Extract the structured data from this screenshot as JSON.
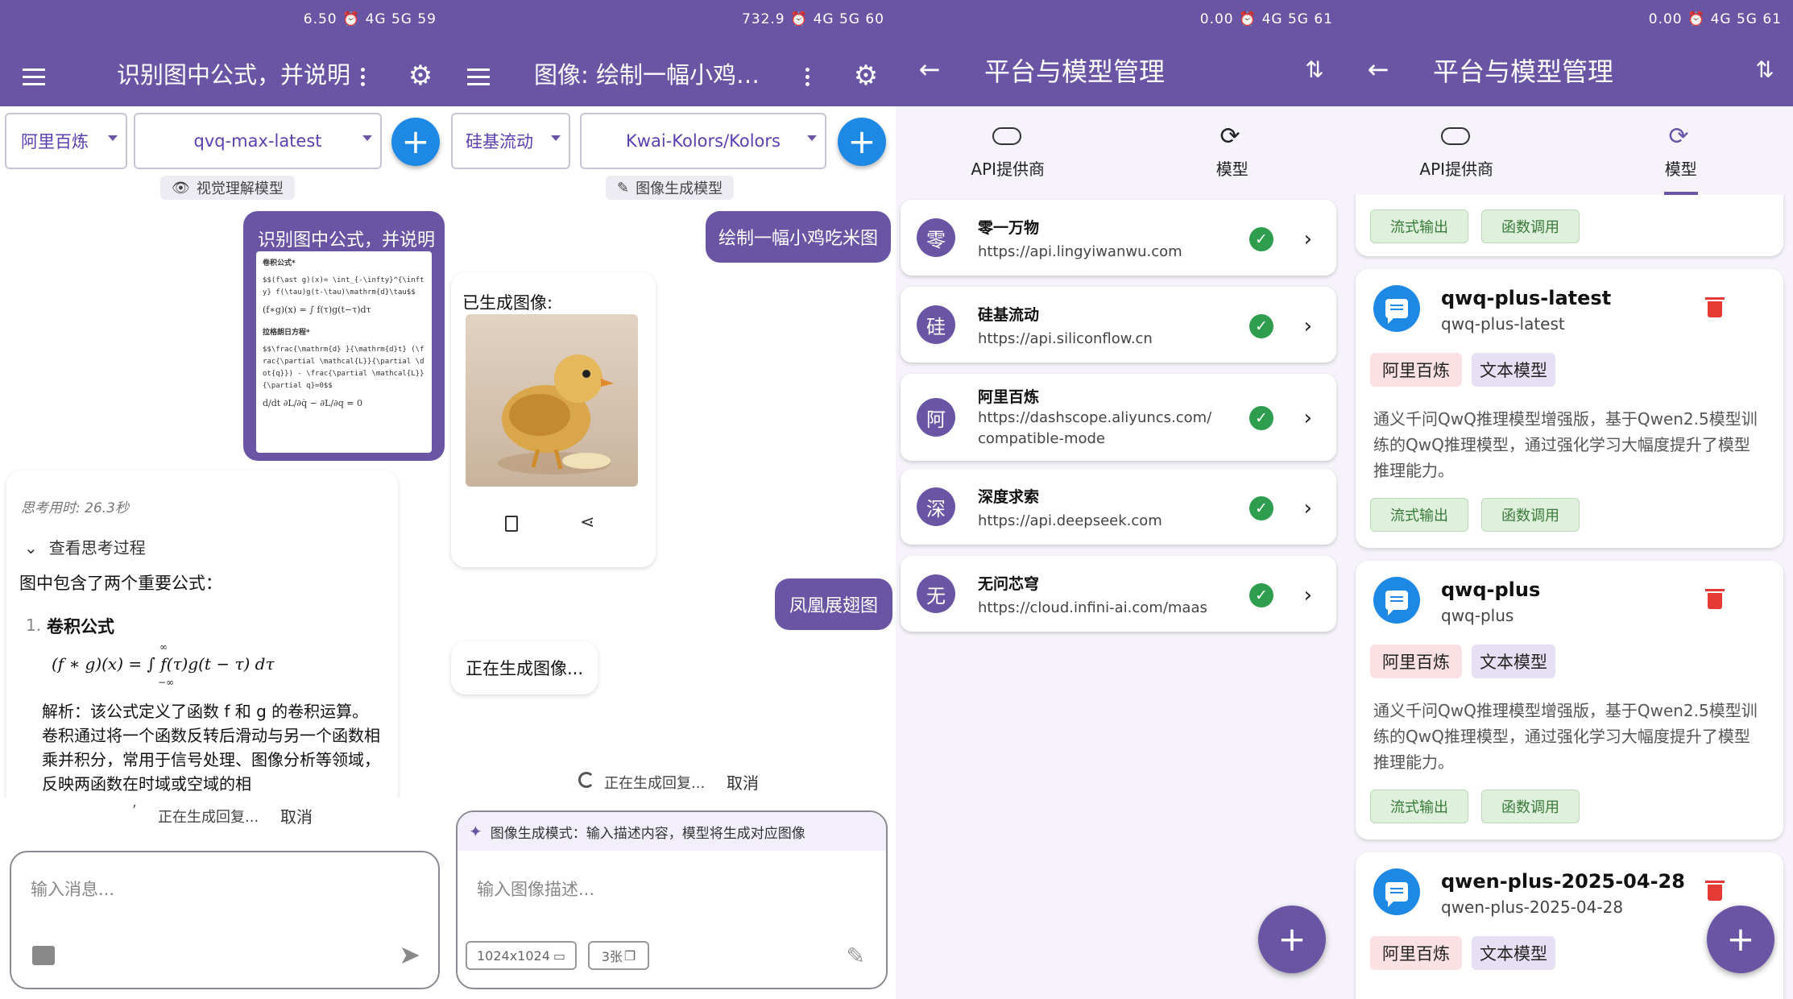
{
  "colors": {
    "primary": "#6a55a5",
    "fab_blue": "#1e88e5",
    "ok_green": "#2e9e4e",
    "delete_red": "#e53935"
  },
  "p1": {
    "status": "6.50 ⏰ 4G 5G 59",
    "title": "识别图中公式，并说明",
    "provider": "阿里百炼",
    "model": "qvq-max-latest",
    "model_badge": "视觉理解模型",
    "user_msg": "识别图中公式，并说明",
    "img_h1": "卷积公式*",
    "img_l1": "$$(f\\ast g)(x)= \\int_{-\\infty}^{\\infty} f(\\tau)g(t-\\tau)\\mathrm{d}\\tau$$",
    "img_l2": "(f∗g)(x) = ∫ f(τ)g(t−τ)dτ",
    "img_h2": "拉格朗日方程*",
    "img_l3": "$$\\frac{\\mathrm{d} }{\\mathrm{d}t} (\\frac{\\partial \\mathcal{L}}{\\partial \\dot{q}}) - \\frac{\\partial \\mathcal{L}}{\\partial q}=0$$",
    "img_l4": "d/dt ∂L/∂q̇ − ∂L/∂q = 0",
    "think_time": "思考用时: 26.3秒",
    "view_thinking": "查看思考过程",
    "answer_intro": "图中包含了两个重要公式：",
    "item_num": "1.",
    "item_title": "卷积公式",
    "formula": "(f ∗ g)(x) = ∫ f(τ)g(t − τ) dτ",
    "f_upper": "∞",
    "f_lower": "−∞",
    "explain": "解析：该公式定义了函数 f 和 g 的卷积运算。卷积通过将一个函数反转后滑动与另一个函数相乘并积分，常用于信号处理、图像分析等领域，反映两函数在时域或空域的相",
    "generating": "正在生成回复...",
    "cancel": "取消",
    "input_placeholder": "输入消息..."
  },
  "p2": {
    "status": "732.9 ⏰ 4G 5G 60",
    "title": "图像: 绘制一幅小鸡…",
    "provider": "硅基流动",
    "model": "Kwai-Kolors/Kolors",
    "model_badge": "图像生成模型",
    "user_msg1": "绘制一幅小鸡吃米图",
    "generated_label": "已生成图像:",
    "user_msg2": "凤凰展翅图",
    "generating_image": "正在生成图像...",
    "generating": "正在生成回复...",
    "cancel": "取消",
    "mode_hint": "图像生成模式：输入描述内容，模型将生成对应图像",
    "input_placeholder": "输入图像描述...",
    "size": "1024x1024",
    "count": "3张"
  },
  "p3": {
    "status": "0.00 ⏰ 4G 5G 61",
    "title": "平台与模型管理",
    "tab1": "API提供商",
    "tab2": "模型",
    "providers": [
      {
        "avatar": "零",
        "name": "零一万物",
        "url": "https://api.lingyiwanwu.com"
      },
      {
        "avatar": "硅",
        "name": "硅基流动",
        "url": "https://api.siliconflow.cn"
      },
      {
        "avatar": "阿",
        "name": "阿里百炼",
        "url": "https://dashscope.aliyuncs.com/",
        "url2": "compatible-mode"
      },
      {
        "avatar": "深",
        "name": "深度求索",
        "url": "https://api.deepseek.com"
      },
      {
        "avatar": "无",
        "name": "无问芯穹",
        "url": "https://cloud.infini-ai.com/maas"
      }
    ]
  },
  "p4": {
    "status": "0.00 ⏰ 4G 5G 61",
    "title": "平台与模型管理",
    "tab1": "API提供商",
    "tab2": "模型",
    "tag_stream": "流式输出",
    "tag_func": "函数调用",
    "models": [
      {
        "name": "qwq-plus-latest",
        "id": "qwq-plus-latest",
        "provider": "阿里百炼",
        "type": "文本模型",
        "desc": "通义千问QwQ推理模型增强版，基于Qwen2.5模型训练的QwQ推理模型，通过强化学习大幅度提升了模型推理能力。"
      },
      {
        "name": "qwq-plus",
        "id": "qwq-plus",
        "provider": "阿里百炼",
        "type": "文本模型",
        "desc": "通义千问QwQ推理模型增强版，基于Qwen2.5模型训练的QwQ推理模型，通过强化学习大幅度提升了模型推理能力。"
      },
      {
        "name": "qwen-plus-2025-04-28",
        "id": "qwen-plus-2025-04-28",
        "provider": "阿里百炼",
        "type": "文本模型"
      }
    ]
  }
}
